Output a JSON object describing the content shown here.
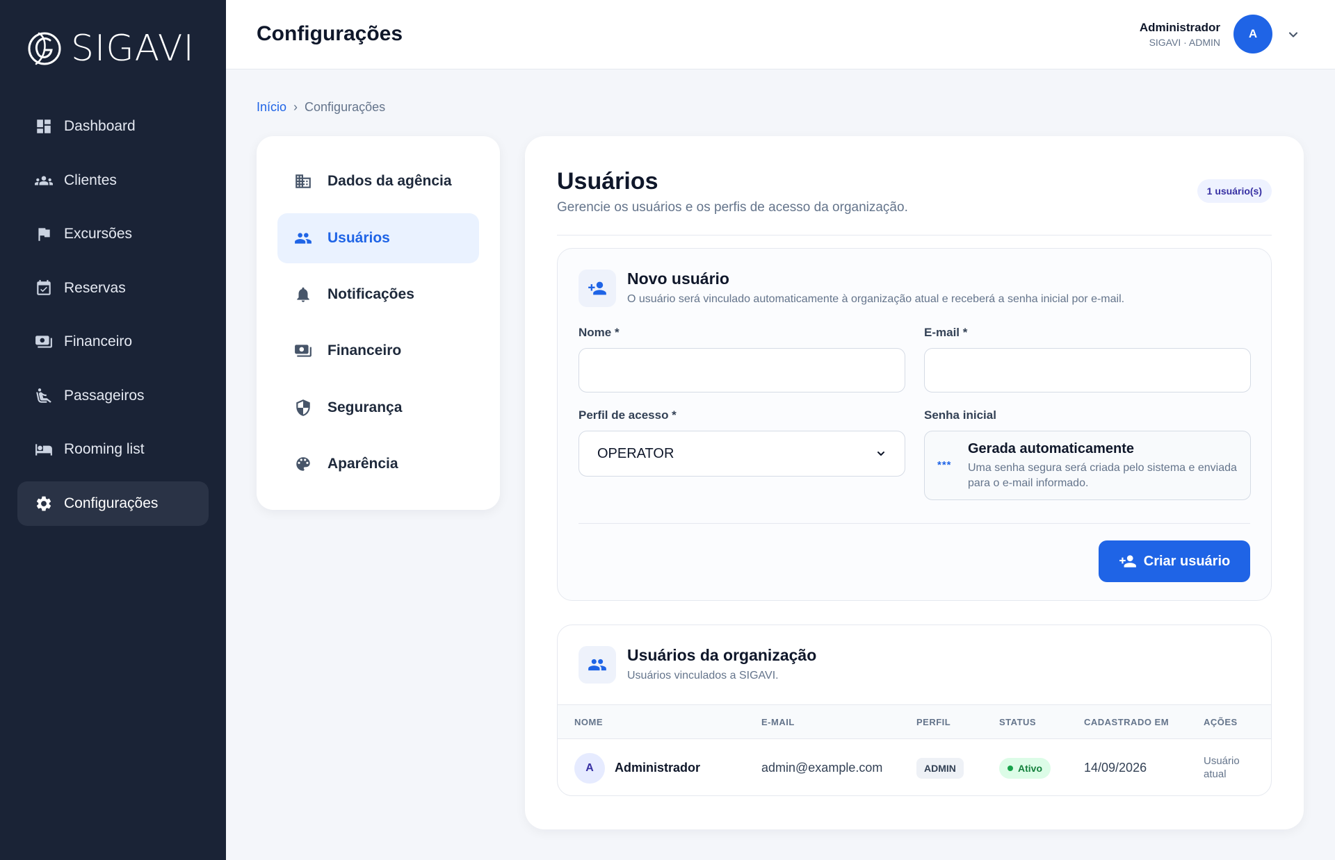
{
  "app": {
    "name": "SIGAVI"
  },
  "sidebar": {
    "items": [
      {
        "label": "Dashboard",
        "icon": "dashboard-icon"
      },
      {
        "label": "Clientes",
        "icon": "people-icon"
      },
      {
        "label": "Excursões",
        "icon": "flag-icon"
      },
      {
        "label": "Reservas",
        "icon": "calendar-check-icon"
      },
      {
        "label": "Financeiro",
        "icon": "money-icon"
      },
      {
        "label": "Passageiros",
        "icon": "seat-icon"
      },
      {
        "label": "Rooming list",
        "icon": "bed-icon"
      },
      {
        "label": "Configurações",
        "icon": "gear-icon",
        "active": true
      }
    ]
  },
  "header": {
    "title": "Configurações",
    "user_name": "Administrador",
    "user_role": "SIGAVI · ADMIN",
    "avatar_initial": "A"
  },
  "breadcrumb": {
    "home": "Início",
    "current": "Configurações"
  },
  "settings_menu": {
    "items": [
      {
        "label": "Dados da agência",
        "icon": "building-icon"
      },
      {
        "label": "Usuários",
        "icon": "users-icon",
        "active": true
      },
      {
        "label": "Notificações",
        "icon": "bell-icon"
      },
      {
        "label": "Financeiro",
        "icon": "money-icon"
      },
      {
        "label": "Segurança",
        "icon": "shield-icon"
      },
      {
        "label": "Aparência",
        "icon": "palette-icon"
      }
    ]
  },
  "users_page": {
    "title": "Usuários",
    "subtitle": "Gerencie os usuários e os perfis de acesso da organização.",
    "count_badge": "1 usuário(s)"
  },
  "new_user": {
    "title": "Novo usuário",
    "subtitle": "O usuário será vinculado automaticamente à organização atual e receberá a senha inicial por e-mail.",
    "name_label": "Nome *",
    "name_value": "",
    "email_label": "E-mail *",
    "email_value": "",
    "profile_label": "Perfil de acesso *",
    "profile_value": "OPERATOR",
    "password_label": "Senha inicial",
    "password_icon_text": "***",
    "password_title": "Gerada automaticamente",
    "password_text": "Uma senha segura será criada pelo sistema e enviada para o e-mail informado.",
    "create_button": "Criar usuário"
  },
  "org_users": {
    "title": "Usuários da organização",
    "subtitle": "Usuários vinculados a SIGAVI.",
    "columns": [
      "NOME",
      "E-MAIL",
      "PERFIL",
      "STATUS",
      "CADASTRADO EM",
      "AÇÕES"
    ],
    "rows": [
      {
        "initial": "A",
        "name": "Administrador",
        "email": "admin@example.com",
        "profile": "ADMIN",
        "status": "Ativo",
        "created": "14/09/2026",
        "action": "Usuário atual"
      }
    ]
  },
  "colors": {
    "sidebar_bg": "#1a2336",
    "accent": "#1f64e6",
    "status_active": "#15803d"
  }
}
